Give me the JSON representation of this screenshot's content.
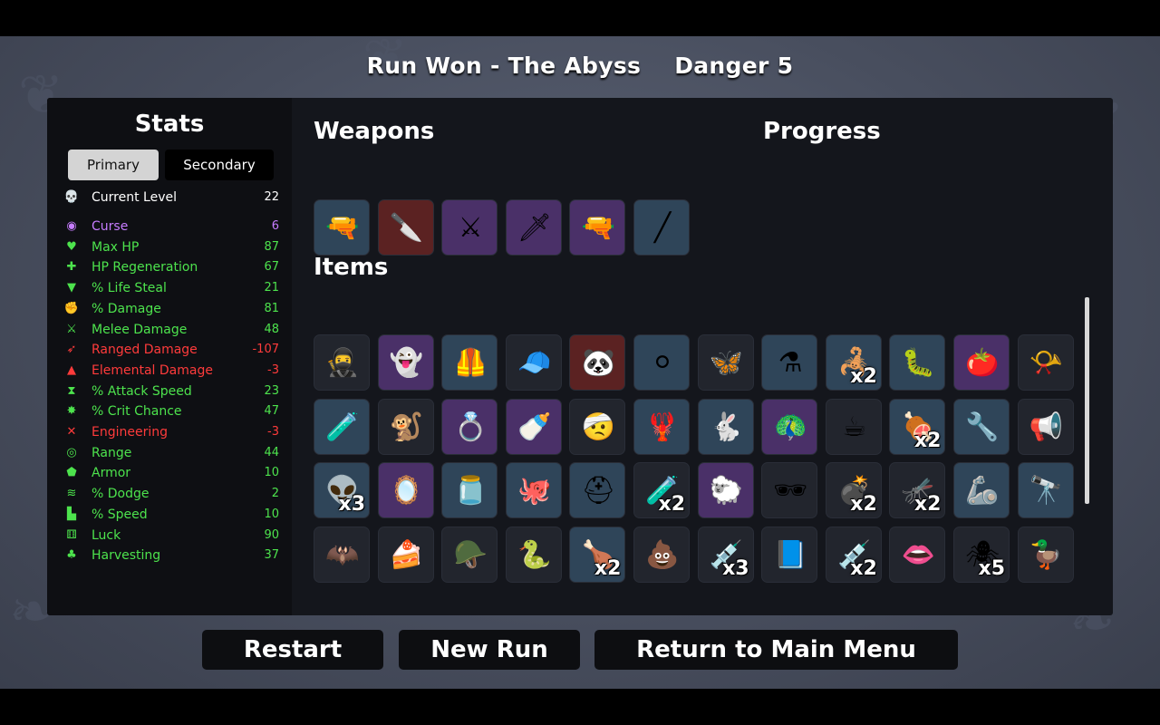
{
  "header": {
    "title": "Run Won - The Abyss",
    "danger": "Danger 5"
  },
  "stats_panel": {
    "title": "Stats",
    "tabs": [
      {
        "label": "Primary",
        "active": true
      },
      {
        "label": "Secondary",
        "active": false
      }
    ],
    "stats": [
      {
        "name": "Current Level",
        "value": "22",
        "color": "#ffffff",
        "icon": "skull-icon"
      },
      {
        "name": "Curse",
        "value": "6",
        "color": "#c67cff",
        "icon": "curse-eye-icon"
      },
      {
        "name": "Max HP",
        "value": "87",
        "color": "#4de34d",
        "icon": "heart-icon"
      },
      {
        "name": "HP Regeneration",
        "value": "67",
        "color": "#4de34d",
        "icon": "heart-plus-icon"
      },
      {
        "name": "% Life Steal",
        "value": "21",
        "color": "#4de34d",
        "icon": "fangs-icon"
      },
      {
        "name": "% Damage",
        "value": "81",
        "color": "#4de34d",
        "icon": "muscle-icon"
      },
      {
        "name": "Melee Damage",
        "value": "48",
        "color": "#4de34d",
        "icon": "sword-icon"
      },
      {
        "name": "Ranged Damage",
        "value": "-107",
        "color": "#ff3b3b",
        "icon": "bow-icon"
      },
      {
        "name": "Elemental Damage",
        "value": "-3",
        "color": "#ff3b3b",
        "icon": "flame-icon"
      },
      {
        "name": "% Attack Speed",
        "value": "23",
        "color": "#4de34d",
        "icon": "hourglass-icon"
      },
      {
        "name": "% Crit Chance",
        "value": "47",
        "color": "#4de34d",
        "icon": "crit-burst-icon"
      },
      {
        "name": "Engineering",
        "value": "-3",
        "color": "#ff3b3b",
        "icon": "wrench-icon"
      },
      {
        "name": "Range",
        "value": "44",
        "color": "#4de34d",
        "icon": "range-icon"
      },
      {
        "name": "Armor",
        "value": "10",
        "color": "#4de34d",
        "icon": "shield-icon"
      },
      {
        "name": "% Dodge",
        "value": "2",
        "color": "#4de34d",
        "icon": "dodge-icon"
      },
      {
        "name": "% Speed",
        "value": "10",
        "color": "#4de34d",
        "icon": "boot-icon"
      },
      {
        "name": "Luck",
        "value": "90",
        "color": "#4de34d",
        "icon": "dice-icon"
      },
      {
        "name": "Harvesting",
        "value": "37",
        "color": "#4de34d",
        "icon": "wheat-icon"
      }
    ]
  },
  "weapons": {
    "title": "Weapons",
    "slots": [
      {
        "icon": "blaster-gun-icon",
        "glyph": "🔫",
        "tier": 1
      },
      {
        "icon": "knife-icon",
        "glyph": "🔪",
        "tier": 3
      },
      {
        "icon": "cutlass-icon",
        "glyph": "⚔",
        "tier": 2
      },
      {
        "icon": "thin-blade-icon",
        "glyph": "🗡",
        "tier": 2
      },
      {
        "icon": "blaster-gun-icon",
        "glyph": "🔫",
        "tier": 2
      },
      {
        "icon": "spear-icon",
        "glyph": "╱",
        "tier": 1
      }
    ]
  },
  "progress": {
    "title": "Progress"
  },
  "items": {
    "title": "Items",
    "slots": [
      {
        "icon": "masked-face-icon",
        "glyph": "🥷",
        "tier": 0,
        "count": ""
      },
      {
        "icon": "ghost-icon",
        "glyph": "👻",
        "tier": 2,
        "count": ""
      },
      {
        "icon": "leather-vest-icon",
        "glyph": "🦺",
        "tier": 1,
        "count": ""
      },
      {
        "icon": "beanie-icon",
        "glyph": "🧢",
        "tier": 0,
        "count": ""
      },
      {
        "icon": "panda-icon",
        "glyph": "🐼",
        "tier": 3,
        "count": ""
      },
      {
        "icon": "pearl-icon",
        "glyph": "⚪",
        "tier": 1,
        "count": ""
      },
      {
        "icon": "butterfly-icon",
        "glyph": "🦋",
        "tier": 0,
        "count": ""
      },
      {
        "icon": "potion-flask-icon",
        "glyph": "⚗",
        "tier": 1,
        "count": ""
      },
      {
        "icon": "scorpion-icon",
        "glyph": "🦂",
        "tier": 1,
        "count": "x2"
      },
      {
        "icon": "grub-worm-icon",
        "glyph": "🐛",
        "tier": 1,
        "count": ""
      },
      {
        "icon": "tomato-face-icon",
        "glyph": "🍅",
        "tier": 2,
        "count": ""
      },
      {
        "icon": "horn-icon",
        "glyph": "📯",
        "tier": 0,
        "count": ""
      },
      {
        "icon": "cauldron-icon",
        "glyph": "🧪",
        "tier": 1,
        "count": ""
      },
      {
        "icon": "monkey-icon",
        "glyph": "🐒",
        "tier": 0,
        "count": ""
      },
      {
        "icon": "ring-icon",
        "glyph": "💍",
        "tier": 2,
        "count": ""
      },
      {
        "icon": "baby-bottle-icon",
        "glyph": "🍼",
        "tier": 2,
        "count": ""
      },
      {
        "icon": "bandage-head-icon",
        "glyph": "🤕",
        "tier": 0,
        "count": ""
      },
      {
        "icon": "tentacle-claw-icon",
        "glyph": "🦞",
        "tier": 1,
        "count": ""
      },
      {
        "icon": "rabbit-icon",
        "glyph": "🐇",
        "tier": 1,
        "count": ""
      },
      {
        "icon": "peacock-icon",
        "glyph": "🦚",
        "tier": 2,
        "count": ""
      },
      {
        "icon": "coffee-cup-icon",
        "glyph": "☕",
        "tier": 0,
        "count": ""
      },
      {
        "icon": "meat-icon",
        "glyph": "🍖",
        "tier": 1,
        "count": "x2"
      },
      {
        "icon": "turret-icon",
        "glyph": "🔧",
        "tier": 1,
        "count": ""
      },
      {
        "icon": "whistle-icon",
        "glyph": "📢",
        "tier": 0,
        "count": ""
      },
      {
        "icon": "alien-icon",
        "glyph": "👽",
        "tier": 1,
        "count": "x3"
      },
      {
        "icon": "mirror-icon",
        "glyph": "🪞",
        "tier": 2,
        "count": ""
      },
      {
        "icon": "jar-icon",
        "glyph": "🫙",
        "tier": 1,
        "count": ""
      },
      {
        "icon": "tentacle-icon",
        "glyph": "🐙",
        "tier": 1,
        "count": ""
      },
      {
        "icon": "helmet-icon",
        "glyph": "⛑",
        "tier": 1,
        "count": ""
      },
      {
        "icon": "green-potion-icon",
        "glyph": "🧪",
        "tier": 0,
        "count": "x2"
      },
      {
        "icon": "tardigrade-icon",
        "glyph": "🐑",
        "tier": 2,
        "count": ""
      },
      {
        "icon": "sunglasses-icon",
        "glyph": "🕶",
        "tier": 0,
        "count": ""
      },
      {
        "icon": "bomb-icon",
        "glyph": "💣",
        "tier": 0,
        "count": "x2"
      },
      {
        "icon": "mosquito-icon",
        "glyph": "🦟",
        "tier": 0,
        "count": "x2"
      },
      {
        "icon": "robot-arm-icon",
        "glyph": "🦾",
        "tier": 1,
        "count": ""
      },
      {
        "icon": "spyglass-icon",
        "glyph": "🔭",
        "tier": 1,
        "count": ""
      },
      {
        "icon": "bat-icon",
        "glyph": "🦇",
        "tier": 0,
        "count": ""
      },
      {
        "icon": "cake-slice-icon",
        "glyph": "🍰",
        "tier": 0,
        "count": ""
      },
      {
        "icon": "iron-helm-icon",
        "glyph": "🪖",
        "tier": 0,
        "count": ""
      },
      {
        "icon": "snake-icon",
        "glyph": "🐍",
        "tier": 0,
        "count": ""
      },
      {
        "icon": "drumstick-icon",
        "glyph": "🍗",
        "tier": 1,
        "count": "x2"
      },
      {
        "icon": "poop-icon",
        "glyph": "💩",
        "tier": 0,
        "count": ""
      },
      {
        "icon": "syringe-icon",
        "glyph": "💉",
        "tier": 0,
        "count": "x3"
      },
      {
        "icon": "book-icon",
        "glyph": "📘",
        "tier": 0,
        "count": ""
      },
      {
        "icon": "red-syringe-icon",
        "glyph": "💉",
        "tier": 0,
        "count": "x2"
      },
      {
        "icon": "fang-mouth-icon",
        "glyph": "👄",
        "tier": 0,
        "count": ""
      },
      {
        "icon": "spider-icon",
        "glyph": "🕷",
        "tier": 0,
        "count": "x5"
      },
      {
        "icon": "rubber-duck-icon",
        "glyph": "🦆",
        "tier": 0,
        "count": ""
      }
    ]
  },
  "buttons": {
    "restart": "Restart",
    "new_run": "New Run",
    "main_menu": "Return to Main Menu"
  }
}
